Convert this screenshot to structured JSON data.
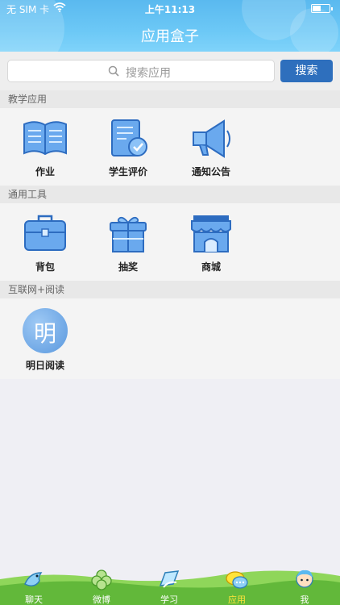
{
  "status": {
    "carrier": "无 SIM 卡",
    "time": "上午11:13"
  },
  "header": {
    "title": "应用盒子"
  },
  "search": {
    "placeholder": "搜索应用",
    "button": "搜索"
  },
  "sections": [
    {
      "title": "教学应用",
      "apps": [
        {
          "label": "作业",
          "icon": "book-icon"
        },
        {
          "label": "学生评价",
          "icon": "evaluation-icon"
        },
        {
          "label": "通知公告",
          "icon": "megaphone-icon"
        }
      ]
    },
    {
      "title": "通用工具",
      "apps": [
        {
          "label": "背包",
          "icon": "bag-icon"
        },
        {
          "label": "抽奖",
          "icon": "gift-icon"
        },
        {
          "label": "商城",
          "icon": "shop-icon"
        }
      ]
    },
    {
      "title": "互联网+阅读",
      "apps": [
        {
          "label": "明日阅读",
          "icon": "mingri-reading-icon",
          "glyph": "明"
        }
      ]
    }
  ],
  "tabs": [
    {
      "label": "聊天",
      "icon": "bird-icon"
    },
    {
      "label": "微博",
      "icon": "clover-icon"
    },
    {
      "label": "学习",
      "icon": "study-icon"
    },
    {
      "label": "应用",
      "icon": "chat-bubbles-icon",
      "active": true
    },
    {
      "label": "我",
      "icon": "profile-avatar-icon"
    }
  ],
  "colors": {
    "header": "#5ab9ef",
    "search_button": "#2e6fbd",
    "icon_blue": "#5b9de8",
    "tab_active": "#ffe33a"
  }
}
